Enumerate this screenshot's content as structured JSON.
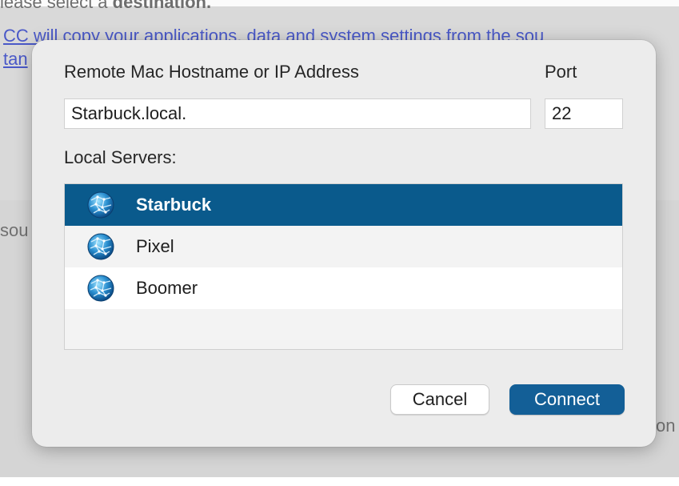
{
  "background": {
    "cut_line_prefix": "lease select a ",
    "cut_line_bold": "destination.",
    "link_line": "CC will copy your applications, data and system settings from the sou",
    "link_line2": "tan",
    "source_label": "sou",
    "right_fragment": "on"
  },
  "dialog": {
    "host_label": "Remote Mac Hostname or IP Address",
    "port_label": "Port",
    "host_value": "Starbuck.local.",
    "port_value": "22",
    "local_servers_label": "Local Servers:",
    "servers": [
      {
        "name": "Starbuck",
        "selected": true,
        "icon": "network-globe-icon"
      },
      {
        "name": "Pixel",
        "selected": false,
        "icon": "network-globe-icon"
      },
      {
        "name": "Boomer",
        "selected": false,
        "icon": "network-globe-icon"
      }
    ],
    "cancel_label": "Cancel",
    "connect_label": "Connect"
  },
  "colors": {
    "selection": "#0a5a8c",
    "primary_button": "#135f97",
    "link": "#4a59c8"
  }
}
